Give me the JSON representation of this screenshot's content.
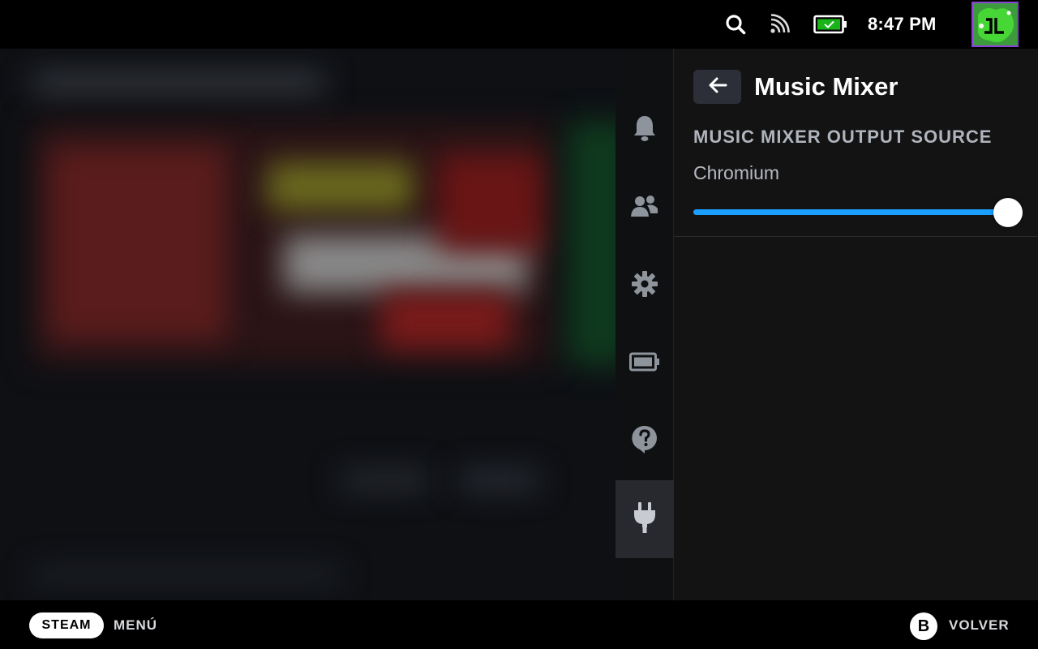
{
  "topbar": {
    "time": "8:47 PM",
    "icons": [
      "search-icon",
      "cast-icon",
      "battery-icon"
    ],
    "battery_color": "#1ab31a",
    "avatar_accent": "#8b3fd9"
  },
  "rail": {
    "items": [
      {
        "icon": "bell-icon"
      },
      {
        "icon": "friends-icon"
      },
      {
        "icon": "gear-icon"
      },
      {
        "icon": "battery-icon"
      },
      {
        "icon": "help-icon"
      },
      {
        "icon": "plug-icon",
        "active": true
      }
    ]
  },
  "panel": {
    "title": "Music Mixer",
    "section_heading": "MUSIC MIXER OUTPUT SOURCE",
    "source_label": "Chromium",
    "slider_value": 1.0,
    "slider_color": "#1a9fff"
  },
  "bottombar": {
    "steam_label": "STEAM",
    "menu_label": "MENÚ",
    "b_button": "B",
    "back_label": "VOLVER"
  }
}
